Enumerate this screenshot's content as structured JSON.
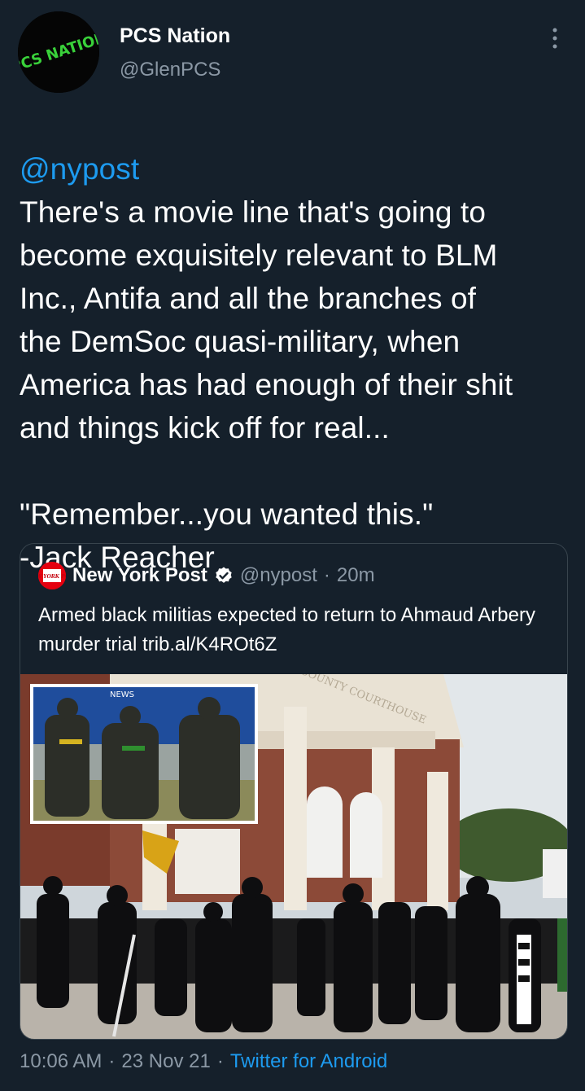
{
  "author": {
    "name": "PCS Nation",
    "handle": "@GlenPCS",
    "avatar_text": "PCS NATION"
  },
  "tweet": {
    "mention": "@nypost",
    "body": "There's a movie line that's going to\nbecome exquisitely relevant to BLM\nInc., Antifa and all the branches of\nthe DemSoc quasi-military, when\nAmerica has had enough of their shit\nand things kick off for real...\n\n\"Remember...you wanted this.\"\n-Jack Reacher"
  },
  "quoted": {
    "name": "New York Post",
    "logo_text": "NEW YORK POST",
    "handle": "@nypost",
    "separator": "·",
    "time": "20m",
    "text": "Armed black militias expected to return to Ahmaud Arbery murder trial trib.al/K4ROt6Z",
    "image_sign_text": "COUNTY COURTHOUSE",
    "inset_van_text": "NEWS"
  },
  "meta": {
    "time": "10:06 AM",
    "sep1": "·",
    "date": "23 Nov 21",
    "sep2": "·",
    "source": "Twitter for Android"
  },
  "colors": {
    "background": "#15202b",
    "accent": "#1d9bf0",
    "muted": "#8b98a5",
    "border": "#38444d"
  }
}
